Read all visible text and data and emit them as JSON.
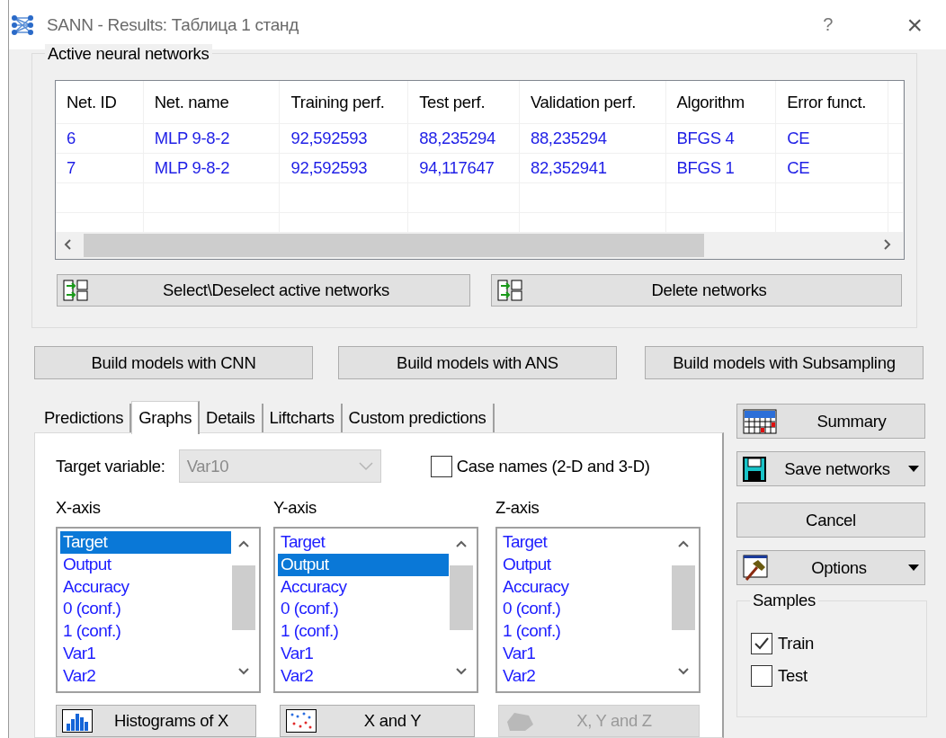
{
  "window": {
    "title": "SANN - Results: Таблица 1 станд",
    "help": "?",
    "close": "×"
  },
  "networks_group": {
    "title": "Active neural networks",
    "table": {
      "columns": [
        "Net. ID",
        "Net. name",
        "Training perf.",
        "Test perf.",
        "Validation perf.",
        "Algorithm",
        "Error funct."
      ],
      "rows": [
        {
          "cells": [
            "6",
            "MLP 9-8-2",
            "92,592593",
            "88,235294",
            "88,235294",
            "BFGS 4",
            "CE"
          ]
        },
        {
          "cells": [
            "7",
            "MLP 9-8-2",
            "92,592593",
            "94,117647",
            "82,352941",
            "BFGS 1",
            "CE"
          ]
        }
      ]
    },
    "buttons": [
      {
        "label": "Select\\Deselect active networks"
      },
      {
        "label": "Delete networks"
      }
    ]
  },
  "build_buttons": [
    "Build models with CNN",
    "Build  models with ANS",
    "Build models with Subsampling"
  ],
  "tabs": [
    {
      "label": "Predictions",
      "selected": false
    },
    {
      "label": "Graphs",
      "selected": true
    },
    {
      "label": "Details",
      "selected": false
    },
    {
      "label": "Liftcharts",
      "selected": false
    },
    {
      "label": "Custom predictions",
      "selected": false
    }
  ],
  "graphs_panel": {
    "target": {
      "label": "Target variable:",
      "value": "Var10",
      "disabled": true
    },
    "case_names": {
      "label": "Case names (2-D and 3-D)",
      "checked": false
    },
    "axes": [
      {
        "label": "X-axis",
        "items": [
          {
            "text": "Target",
            "selected": true
          },
          {
            "text": "Output",
            "selected": false
          },
          {
            "text": "Accuracy",
            "selected": false
          },
          {
            "text": "0 (conf.)",
            "selected": false
          },
          {
            "text": "1 (conf.)",
            "selected": false
          },
          {
            "text": "Var1",
            "selected": false
          },
          {
            "text": "Var2",
            "selected": false
          }
        ]
      },
      {
        "label": "Y-axis",
        "items": [
          {
            "text": "Target",
            "selected": false
          },
          {
            "text": "Output",
            "selected": true
          },
          {
            "text": "Accuracy",
            "selected": false
          },
          {
            "text": "0 (conf.)",
            "selected": false
          },
          {
            "text": "1 (conf.)",
            "selected": false
          },
          {
            "text": "Var1",
            "selected": false
          },
          {
            "text": "Var2",
            "selected": false
          }
        ]
      },
      {
        "label": "Z-axis",
        "items": [
          {
            "text": "Target",
            "selected": false
          },
          {
            "text": "Output",
            "selected": false
          },
          {
            "text": "Accuracy",
            "selected": false
          },
          {
            "text": "0 (conf.)",
            "selected": false
          },
          {
            "text": "1 (conf.)",
            "selected": false
          },
          {
            "text": "Var1",
            "selected": false
          },
          {
            "text": "Var2",
            "selected": false
          }
        ]
      }
    ],
    "plot_buttons": [
      {
        "label": "Histograms of X",
        "kind": "histogram",
        "disabled": false
      },
      {
        "label": "X and Y",
        "kind": "scatter",
        "disabled": false
      },
      {
        "label": "X, Y and Z",
        "kind": "surface",
        "disabled": true
      }
    ]
  },
  "side_buttons": [
    {
      "label": "Summary",
      "kind": "summary",
      "dropdown": false
    },
    {
      "label": "Save networks",
      "kind": "save",
      "dropdown": true
    },
    {
      "label": "Cancel",
      "kind": "plain",
      "dropdown": false
    },
    {
      "label": "Options",
      "kind": "options",
      "dropdown": true
    }
  ],
  "samples": {
    "title": "Samples",
    "items": [
      {
        "label": "Train",
        "checked": true
      },
      {
        "label": "Test",
        "checked": false
      }
    ]
  }
}
